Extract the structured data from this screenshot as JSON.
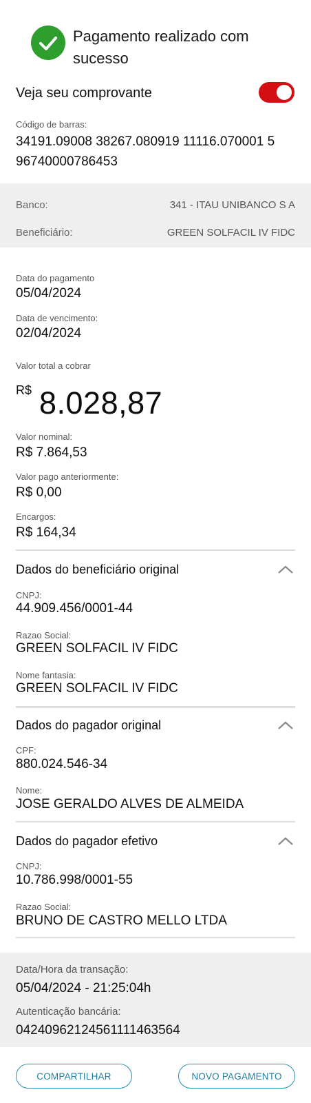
{
  "header": {
    "success_title": "Pagamento realizado com sucesso",
    "receipt_label": "Veja seu comprovante",
    "toggle_on": true,
    "accent_color": "#d40f14",
    "success_color": "#2e9e2e"
  },
  "barcode": {
    "label": "Código de barras:",
    "value": "34191.09008 38267.080919 11116.070001 5 96740000786453"
  },
  "bank": {
    "bank_label": "Banco:",
    "bank_value": "341 - ITAU UNIBANCO S A",
    "beneficiary_label": "Beneficiário:",
    "beneficiary_value": "GREEN SOLFACIL IV FIDC"
  },
  "payment": {
    "payment_date_label": "Data do pagamento",
    "payment_date": "05/04/2024",
    "due_date_label": "Data de vencimento:",
    "due_date": "02/04/2024",
    "total_label": "Valor total a cobrar",
    "currency": "R$",
    "total_value": "8.028,87",
    "nominal_label": "Valor nominal:",
    "nominal_value": "R$ 7.864,53",
    "previous_label": "Valor pago anteriormente:",
    "previous_value": "R$ 0,00",
    "charges_label": "Encargos:",
    "charges_value": "R$ 164,34"
  },
  "original_beneficiary": {
    "title": "Dados do beneficiário original",
    "cnpj_label": "CNPJ:",
    "cnpj": "44.909.456/0001-44",
    "company_label": "Razao Social:",
    "company": "GREEN SOLFACIL IV FIDC",
    "trade_label": "Nome fantasia:",
    "trade_name": "GREEN SOLFACIL IV FIDC"
  },
  "original_payer": {
    "title": "Dados do pagador original",
    "cpf_label": "CPF:",
    "cpf": "880.024.546-34",
    "name_label": "Nome:",
    "name": "JOSE GERALDO ALVES DE ALMEIDA"
  },
  "effective_payer": {
    "title": "Dados do pagador efetivo",
    "cnpj_label": "CNPJ:",
    "cnpj": "10.786.998/0001-55",
    "company_label": "Razao Social:",
    "company": "BRUNO DE CASTRO MELLO LTDA"
  },
  "transaction": {
    "datetime_label": "Data/Hora da transação:",
    "datetime": "05/04/2024 - 21:25:04h",
    "auth_label": "Autenticação bancária:",
    "auth": "04240962124561111463564"
  },
  "actions": {
    "share_label": "COMPARTILHAR",
    "new_payment_label": "NOVO PAGAMENTO"
  }
}
